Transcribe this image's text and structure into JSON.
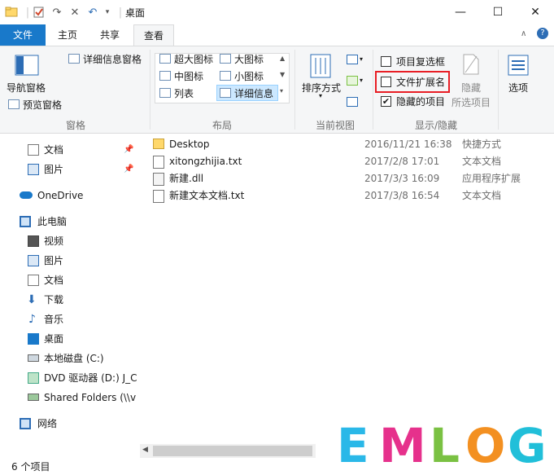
{
  "window": {
    "title": "桌面",
    "minimize": "—",
    "maximize": "☐",
    "close": "✕"
  },
  "tabs": [
    {
      "label": "文件"
    },
    {
      "label": "主页"
    },
    {
      "label": "共享"
    },
    {
      "label": "查看"
    }
  ],
  "ribbon": {
    "panes": {
      "nav_pane": "导航窗格",
      "preview_pane": "预览窗格",
      "details_pane": "详细信息窗格",
      "group_label": "窗格"
    },
    "layout": {
      "items": [
        "超大图标",
        "大图标",
        "中图标",
        "小图标",
        "列表",
        "详细信息"
      ],
      "selected": "详细信息",
      "group_label": "布局"
    },
    "current_view": {
      "sort_by": "排序方式",
      "group_label": "当前视图"
    },
    "show_hide": {
      "item_checkboxes": "项目复选框",
      "item_checkboxes_checked": false,
      "file_extensions": "文件扩展名",
      "file_extensions_checked": false,
      "hidden_items": "隐藏的项目",
      "hidden_items_checked": true,
      "hide_selected_line1": "隐藏",
      "hide_selected_line2": "所选项目",
      "group_label": "显示/隐藏"
    },
    "options": "选项"
  },
  "nav": {
    "items": [
      {
        "label": "文档",
        "pinned": true
      },
      {
        "label": "图片",
        "pinned": true
      },
      {
        "label": "OneDrive"
      },
      {
        "label": "此电脑"
      },
      {
        "label": "视频"
      },
      {
        "label": "图片"
      },
      {
        "label": "文档"
      },
      {
        "label": "下载"
      },
      {
        "label": "音乐"
      },
      {
        "label": "桌面"
      },
      {
        "label": "本地磁盘 (C:)"
      },
      {
        "label": "DVD 驱动器 (D:) J_C"
      },
      {
        "label": "Shared Folders (\\\\v"
      },
      {
        "label": "网络"
      }
    ]
  },
  "files": [
    {
      "name": "Desktop",
      "date": "2016/11/21 16:38",
      "type": "快捷方式"
    },
    {
      "name": "xitongzhijia.txt",
      "date": "2017/2/8 17:01",
      "type": "文本文档"
    },
    {
      "name": "新建.dll",
      "date": "2017/3/3 16:09",
      "type": "应用程序扩展"
    },
    {
      "name": "新建文本文档.txt",
      "date": "2017/3/8 16:54",
      "type": "文本文档"
    }
  ],
  "status": {
    "count": "6 个项目"
  },
  "watermark": {
    "letters": [
      "E",
      "M",
      "L",
      "O",
      "G"
    ],
    "colors": [
      "#2ab8e8",
      "#e6318c",
      "#7ac142",
      "#f39021",
      "#21bfd9"
    ]
  },
  "colors": {
    "accent": "#1979ca",
    "highlight": "#e81e25"
  }
}
